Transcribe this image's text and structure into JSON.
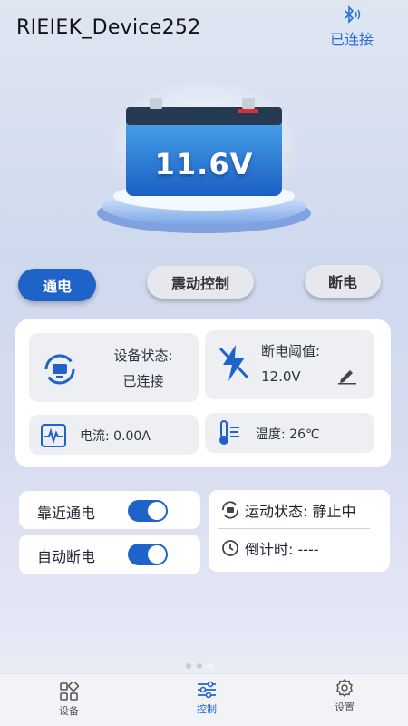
{
  "header": {
    "device_name": "RIEIEK_Device252",
    "connection_label": "已连接"
  },
  "hero": {
    "voltage": "11.6V"
  },
  "modes": {
    "power_on": "通电",
    "vibration_control": "震动控制",
    "power_off": "断电",
    "selected": "通电"
  },
  "status_panel": {
    "device_status_label": "设备状态:",
    "device_status_value": "已连接",
    "cutoff_threshold_label": "断电阈值:",
    "cutoff_threshold_value": "12.0V",
    "current_text": "电流: 0.00A",
    "temperature_text": "温度: 26℃"
  },
  "settings": {
    "proximity_power": {
      "label": "靠近通电",
      "enabled": true
    },
    "auto_cutoff": {
      "label": "自动断电",
      "enabled": true
    },
    "motion_state": "运动状态: 静止中",
    "countdown": "倒计时: ----"
  },
  "nav": {
    "items": [
      "设备",
      "控制",
      "设置"
    ],
    "active": "控制"
  },
  "colors": {
    "accent": "#1f63c9",
    "background": "#d6dcf0"
  }
}
